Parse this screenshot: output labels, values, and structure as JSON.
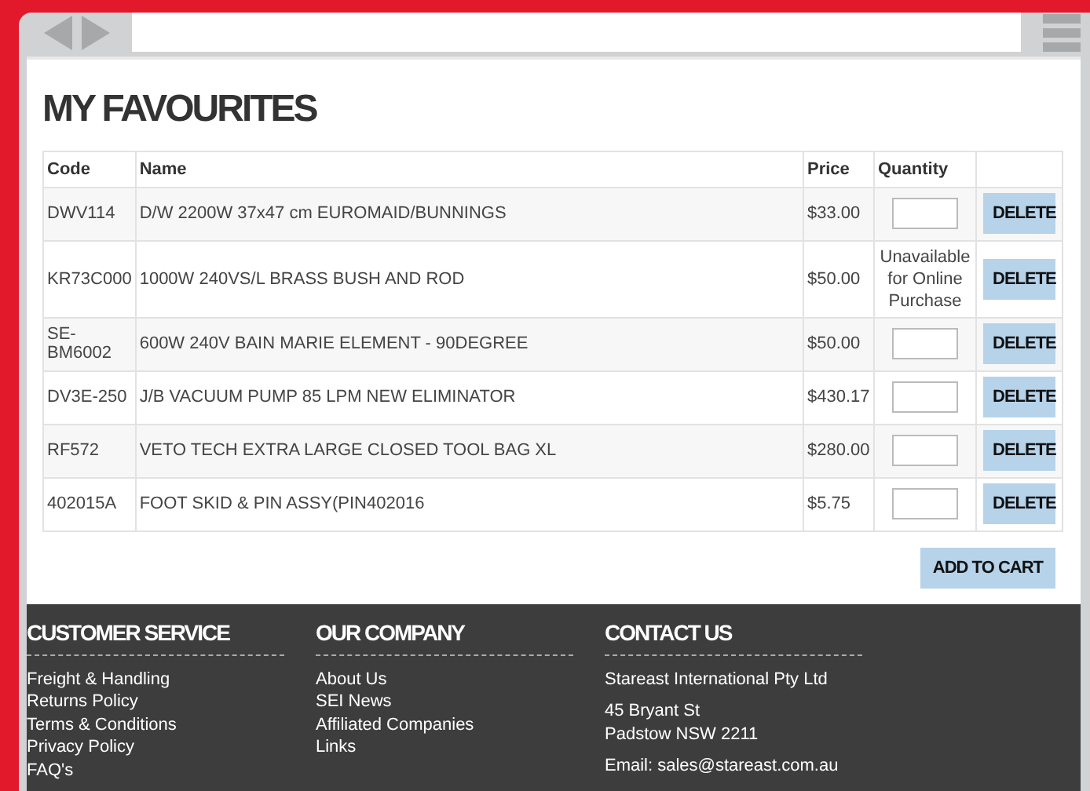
{
  "page": {
    "title": "MY FAVOURITES"
  },
  "table": {
    "columns": [
      "Code",
      "Name",
      "Price",
      "Quantity"
    ],
    "rows": [
      {
        "code": "DWV114",
        "name": "D/W 2200W 37x47 cm EUROMAID/BUNNINGS",
        "price": "$33.00",
        "quantity": {
          "kind": "input"
        },
        "action": "DELETE"
      },
      {
        "code": "KR73C000",
        "name": "1000W 240VS/L BRASS BUSH AND ROD",
        "price": "$50.00",
        "quantity": {
          "kind": "unavailable",
          "text": "Unavailable for Online Purchase"
        },
        "action": "DELETE"
      },
      {
        "code": "SE-BM6002",
        "name": "600W 240V BAIN MARIE ELEMENT - 90DEGREE",
        "price": "$50.00",
        "quantity": {
          "kind": "input"
        },
        "action": "DELETE"
      },
      {
        "code": "DV3E-250",
        "name": "J/B VACUUM PUMP 85 LPM NEW ELIMINATOR",
        "price": "$430.17",
        "quantity": {
          "kind": "input"
        },
        "action": "DELETE"
      },
      {
        "code": "RF572",
        "name": "VETO TECH EXTRA LARGE CLOSED TOOL BAG XL",
        "price": "$280.00",
        "quantity": {
          "kind": "input"
        },
        "action": "DELETE"
      },
      {
        "code": "402015A",
        "name": "FOOT SKID & PIN ASSY(PIN402016",
        "price": "$5.75",
        "quantity": {
          "kind": "input"
        },
        "action": "DELETE"
      }
    ]
  },
  "add_to_cart": "ADD TO CART",
  "footer": {
    "columns": [
      {
        "heading": "CUSTOMER SERVICE",
        "groups": [
          [
            "Freight & Handling",
            "Returns Policy",
            "Terms & Conditions",
            "Privacy Policy",
            "FAQ's"
          ]
        ]
      },
      {
        "heading": "OUR COMPANY",
        "groups": [
          [
            "About Us",
            "SEI News",
            "Affiliated Companies",
            "Links"
          ]
        ]
      },
      {
        "heading": "CONTACT US",
        "groups": [
          [
            "Stareast International Pty Ltd"
          ],
          [
            "45 Bryant St",
            "Padstow NSW 2211"
          ],
          [
            "Email: sales@stareast.com.au"
          ]
        ]
      }
    ]
  }
}
